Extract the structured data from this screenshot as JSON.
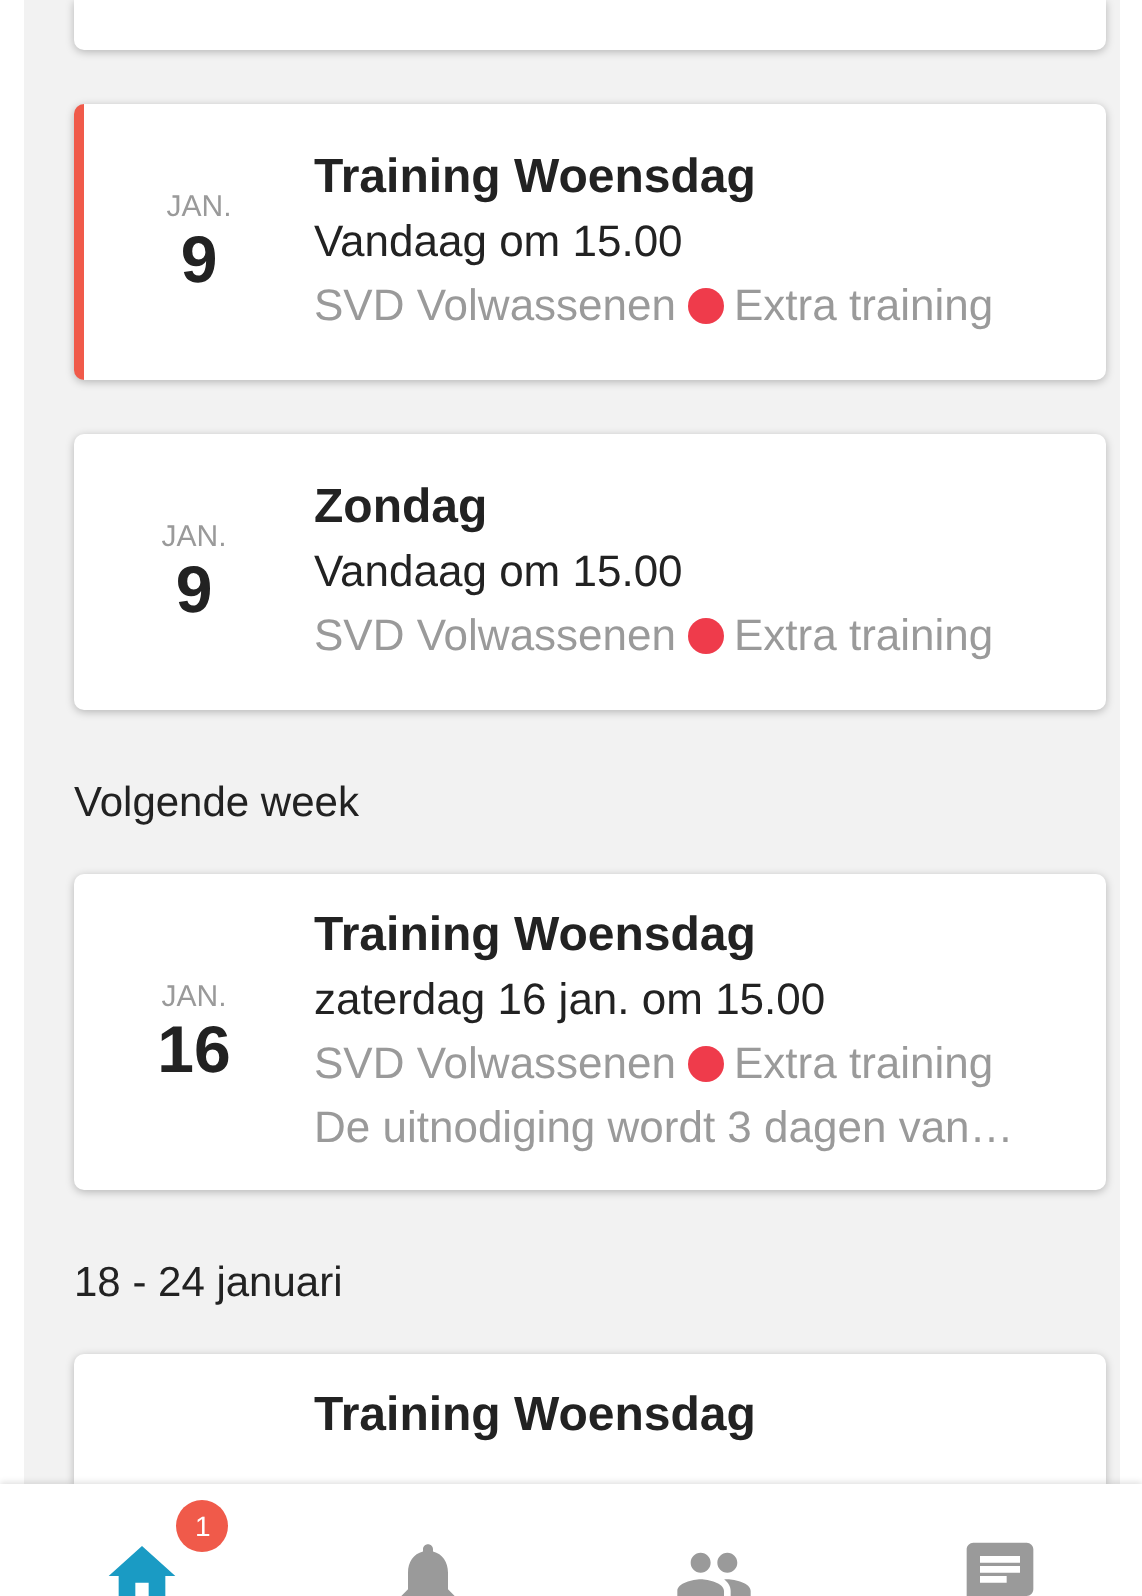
{
  "sections": [
    {
      "events": [
        {
          "month": "JAN.",
          "day": "9",
          "title": "Training Woensdag",
          "when": "Vandaag om 15.00",
          "team": "SVD Volwassenen",
          "type": "Extra training",
          "color": "#ef3b4b",
          "accent": true
        },
        {
          "month": "JAN.",
          "day": "9",
          "title": "Zondag",
          "when": "Vandaag om 15.00",
          "team": "SVD Volwassenen",
          "type": "Extra training",
          "color": "#ef3b4b",
          "accent": false
        }
      ]
    },
    {
      "heading": "Volgende week",
      "events": [
        {
          "month": "JAN.",
          "day": "16",
          "title": "Training Woensdag",
          "when": "zaterdag 16 jan. om 15.00",
          "team": "SVD Volwassenen",
          "type": "Extra training",
          "color": "#ef3b4b",
          "note": "De uitnodiging wordt 3 dagen van…",
          "accent": false
        }
      ]
    },
    {
      "heading": "18 - 24 januari",
      "events": [
        {
          "title": "Training Woensdag",
          "accent": false
        }
      ]
    }
  ],
  "bottom_nav": [
    {
      "kind": "home",
      "selected": true,
      "badge": "1"
    },
    {
      "kind": "bell",
      "selected": false
    },
    {
      "kind": "people",
      "selected": false
    },
    {
      "kind": "chat",
      "selected": false
    }
  ]
}
